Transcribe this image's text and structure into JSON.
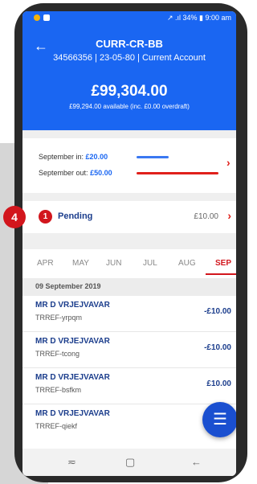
{
  "status_bar": {
    "right": "↗ .ıl 34% ▮ 9:00 am"
  },
  "header": {
    "back_icon": "←",
    "account_name": "CURR-CR-BB",
    "account_details": "34566356 | 23-05-80 | Current Account",
    "balance": "£99,304.00",
    "available": "£99,294.00 available (inc. £0.00 overdraft)"
  },
  "summary": {
    "in_label": "September in:",
    "in_value": "£20.00",
    "out_label": "September out:",
    "out_value": "£50.00",
    "in_color": "#3a78f2",
    "out_color": "#e0201b"
  },
  "pending": {
    "badge": "1",
    "label": "Pending",
    "amount": "£10.00"
  },
  "callout": "4",
  "months": [
    "APR",
    "MAY",
    "JUN",
    "JUL",
    "AUG",
    "SEP"
  ],
  "active_month": "SEP",
  "date_header": "09 September 2019",
  "transactions": [
    {
      "name": "MR D VRJEJVAVAR",
      "ref": "TRREF-yrpqm",
      "amount": "-£10.00"
    },
    {
      "name": "MR D VRJEJVAVAR",
      "ref": "TRREF-tcong",
      "amount": "-£10.00"
    },
    {
      "name": "MR D VRJEJVAVAR",
      "ref": "TRREF-bsfkm",
      "amount": "£10.00"
    },
    {
      "name": "MR D VRJEJVAVAR",
      "ref": "TRREF-qiekf",
      "amount": "-£"
    }
  ],
  "fab_icon": "☰",
  "nav": {
    "back": "←",
    "home": "▢",
    "recents": "≂"
  }
}
